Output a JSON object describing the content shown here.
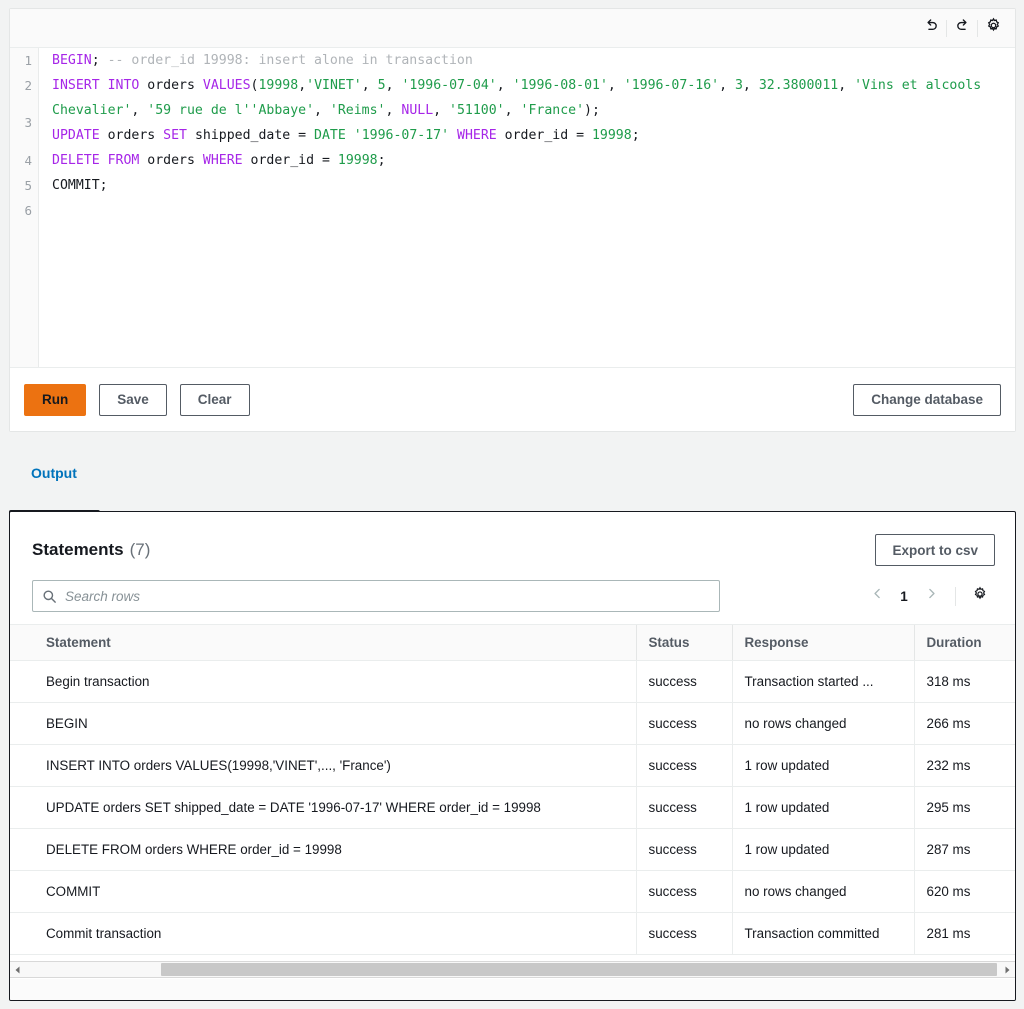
{
  "editor": {
    "toolbar": {
      "undo_icon": "undo-icon",
      "redo_icon": "redo-icon",
      "settings_icon": "gear-icon"
    },
    "line_numbers": [
      "1",
      "2",
      "3",
      "4",
      "5",
      "6"
    ],
    "sql_lines": [
      {
        "number": "1",
        "tokens": [
          {
            "t": "BEGIN",
            "c": "kw"
          },
          {
            "t": ";",
            "c": "plain"
          },
          {
            "t": " -- order_id 19998: insert alone in transaction",
            "c": "cmt"
          }
        ]
      },
      {
        "number": "2",
        "tokens": [
          {
            "t": "INSERT",
            "c": "kw"
          },
          {
            "t": " ",
            "c": "plain"
          },
          {
            "t": "INTO",
            "c": "kw"
          },
          {
            "t": " orders ",
            "c": "plain"
          },
          {
            "t": "VALUES",
            "c": "kw"
          },
          {
            "t": "(",
            "c": "plain"
          },
          {
            "t": "19998",
            "c": "num"
          },
          {
            "t": ",",
            "c": "plain"
          },
          {
            "t": "'VINET'",
            "c": "str"
          },
          {
            "t": ", ",
            "c": "plain"
          },
          {
            "t": "5",
            "c": "num"
          },
          {
            "t": ", ",
            "c": "plain"
          },
          {
            "t": "'1996-07-04'",
            "c": "str"
          },
          {
            "t": ", ",
            "c": "plain"
          },
          {
            "t": "'1996-08-01'",
            "c": "str"
          },
          {
            "t": ", ",
            "c": "plain"
          },
          {
            "t": "'1996-07-16'",
            "c": "str"
          },
          {
            "t": ", ",
            "c": "plain"
          },
          {
            "t": "3",
            "c": "num"
          },
          {
            "t": ", ",
            "c": "plain"
          },
          {
            "t": "32.3800011",
            "c": "num"
          },
          {
            "t": ", ",
            "c": "plain"
          },
          {
            "t": "'Vins et alcools Chevalier'",
            "c": "str"
          },
          {
            "t": ", ",
            "c": "plain"
          },
          {
            "t": "'59 rue de l''Abbaye'",
            "c": "str"
          },
          {
            "t": ", ",
            "c": "plain"
          },
          {
            "t": "'Reims'",
            "c": "str"
          },
          {
            "t": ", ",
            "c": "plain"
          },
          {
            "t": "NULL",
            "c": "kw"
          },
          {
            "t": ", ",
            "c": "plain"
          },
          {
            "t": "'51100'",
            "c": "str"
          },
          {
            "t": ", ",
            "c": "plain"
          },
          {
            "t": "'France'",
            "c": "str"
          },
          {
            "t": ");",
            "c": "plain"
          }
        ]
      },
      {
        "number": "3",
        "tokens": [
          {
            "t": "UPDATE",
            "c": "kw"
          },
          {
            "t": " orders ",
            "c": "plain"
          },
          {
            "t": "SET",
            "c": "kw"
          },
          {
            "t": " shipped_date = ",
            "c": "plain"
          },
          {
            "t": "DATE",
            "c": "str"
          },
          {
            "t": " ",
            "c": "plain"
          },
          {
            "t": "'1996-07-17'",
            "c": "str"
          },
          {
            "t": " ",
            "c": "plain"
          },
          {
            "t": "WHERE",
            "c": "kw"
          },
          {
            "t": " order_id = ",
            "c": "plain"
          },
          {
            "t": "19998",
            "c": "num"
          },
          {
            "t": ";",
            "c": "plain"
          }
        ]
      },
      {
        "number": "4",
        "tokens": [
          {
            "t": "DELETE",
            "c": "kw"
          },
          {
            "t": " ",
            "c": "plain"
          },
          {
            "t": "FROM",
            "c": "kw"
          },
          {
            "t": " orders ",
            "c": "plain"
          },
          {
            "t": "WHERE",
            "c": "kw"
          },
          {
            "t": " order_id = ",
            "c": "plain"
          },
          {
            "t": "19998",
            "c": "num"
          },
          {
            "t": ";",
            "c": "plain"
          }
        ]
      },
      {
        "number": "5",
        "tokens": [
          {
            "t": "COMMIT;",
            "c": "plain"
          }
        ]
      },
      {
        "number": "6",
        "tokens": []
      }
    ],
    "actions": {
      "run_label": "Run",
      "save_label": "Save",
      "clear_label": "Clear",
      "change_database_label": "Change database"
    }
  },
  "tabs": {
    "output_label": "Output"
  },
  "output": {
    "title": "Statements",
    "count": "(7)",
    "export_label": "Export to csv",
    "search": {
      "placeholder": "Search rows",
      "value": "",
      "icon": "search-icon"
    },
    "pagination": {
      "prev_icon": "chevron-left-icon",
      "page": "1",
      "next_icon": "chevron-right-icon",
      "settings_icon": "gear-icon"
    },
    "columns": [
      "Statement",
      "Status",
      "Response",
      "Duration"
    ],
    "rows": [
      {
        "statement": "Begin transaction",
        "status": "success",
        "response": "Transaction started ...",
        "duration": "318 ms"
      },
      {
        "statement": "BEGIN",
        "status": "success",
        "response": "no rows changed",
        "duration": "266 ms"
      },
      {
        "statement": "INSERT INTO orders VALUES(19998,'VINET',..., 'France')",
        "status": "success",
        "response": "1 row updated",
        "duration": "232 ms"
      },
      {
        "statement": "UPDATE orders SET shipped_date = DATE '1996-07-17' WHERE order_id = 19998",
        "status": "success",
        "response": "1 row updated",
        "duration": "295 ms"
      },
      {
        "statement": "DELETE FROM orders WHERE order_id = 19998",
        "status": "success",
        "response": "1 row updated",
        "duration": "287 ms"
      },
      {
        "statement": "COMMIT",
        "status": "success",
        "response": "no rows changed",
        "duration": "620 ms"
      },
      {
        "statement": "Commit transaction",
        "status": "success",
        "response": "Transaction committed",
        "duration": "281 ms"
      }
    ]
  },
  "colors": {
    "accent_orange": "#ec7211",
    "link_blue": "#0073bb",
    "keyword_purple": "#a626e8",
    "string_green": "#1f9c4b",
    "comment_gray": "#b0b4b8",
    "border_dark": "#16191f"
  }
}
